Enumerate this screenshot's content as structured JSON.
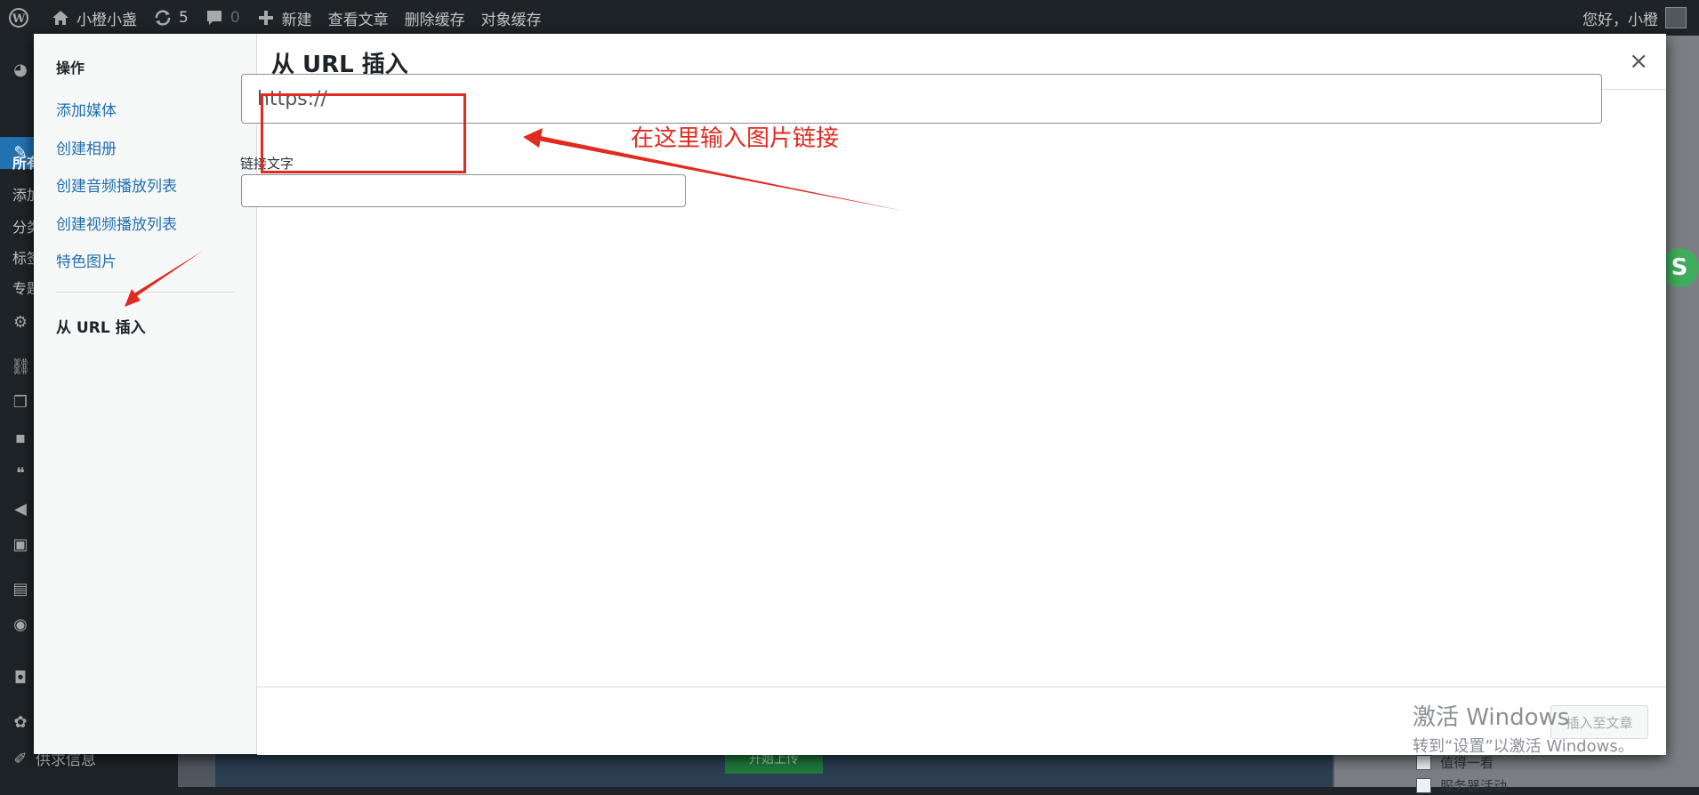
{
  "admin_bar": {
    "site_name": "小橙小盏",
    "updates_count": "5",
    "comments_count": "0",
    "new_label": "新建",
    "view_post_label": "查看文章",
    "clear_cache_label": "删除缓存",
    "object_cache_label": "对象缓存",
    "greeting": "您好，小橙"
  },
  "admin_menu": {
    "visible_fragments": [
      "所有",
      "添加",
      "分类",
      "标签",
      "专题"
    ],
    "bottom_item": "供求信息"
  },
  "modal": {
    "sidebar": {
      "heading": "操作",
      "links": [
        "添加媒体",
        "创建相册",
        "创建音频播放列表",
        "创建视频播放列表",
        "特色图片"
      ],
      "active_item": "从 URL 插入"
    },
    "title": "从 URL 插入",
    "close_symbol": "×",
    "url_field": {
      "value": "https://"
    },
    "link_text": {
      "label": "链接文字",
      "value": ""
    },
    "insert_button_label": "插入至文章"
  },
  "annotation": {
    "note": "在这里输入图片链接",
    "color": "#e02b20"
  },
  "background": {
    "checkbox_items": [
      "值得一看",
      "服务器活动"
    ],
    "upload_button_label": "开始上传"
  },
  "watermark": {
    "line1": "激活 Windows",
    "line2": "转到“设置”以激活 Windows。"
  },
  "icons": [
    "wordpress-icon",
    "home-icon",
    "updates-icon",
    "comments-icon",
    "plus-icon",
    "close-icon",
    "pin-icon"
  ],
  "colors": {
    "admin_bar_bg": "#1d2327",
    "link": "#2271b1",
    "accent": "#2271b1"
  }
}
